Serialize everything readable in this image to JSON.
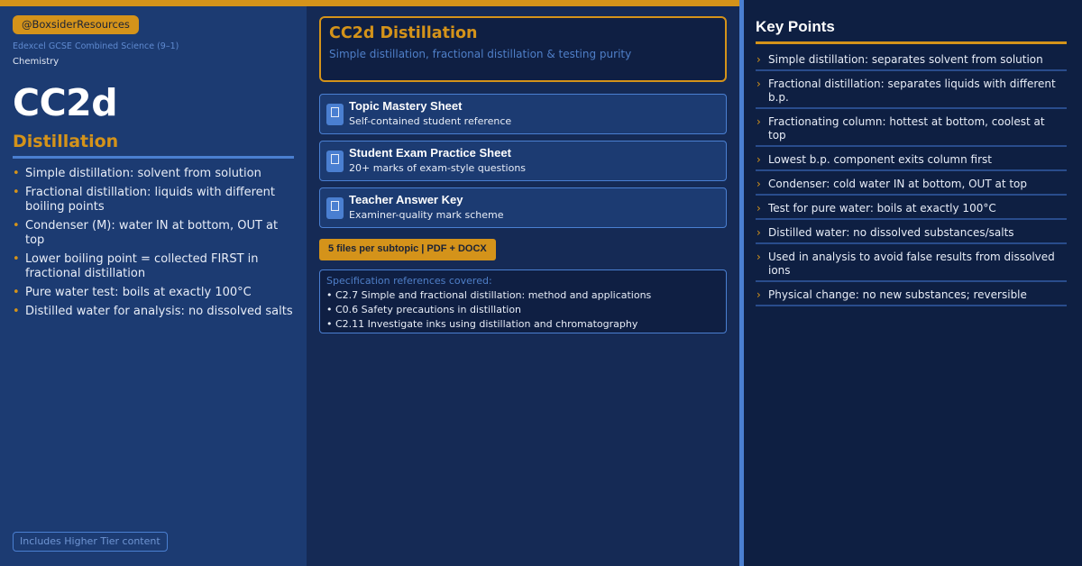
{
  "left": {
    "handle": "@BoxsiderResources",
    "board": "Edexcel GCSE Combined Science (9–1)",
    "subject": "Chemistry",
    "code": "CC2d",
    "topic": "Distillation",
    "bullets": [
      "Simple distillation: solvent from solution",
      "Fractional distillation: liquids with different boiling points",
      "Condenser (M): water IN at bottom, OUT at top",
      "Lower boiling point = collected FIRST in fractional distillation",
      "Pure water test: boils at exactly 100°C",
      "Distilled water for analysis: no dissolved salts"
    ],
    "hint": "Includes Higher Tier content"
  },
  "middle": {
    "header_title": "CC2d Distillation",
    "header_sub": "Simple distillation, fractional distillation & testing purity",
    "files": [
      {
        "name": "Topic Mastery Sheet",
        "desc": "Self-contained student reference"
      },
      {
        "name": "Student Exam Practice Sheet",
        "desc": "20+ marks of exam-style questions"
      },
      {
        "name": "Teacher Answer Key",
        "desc": "Examiner-quality mark scheme"
      }
    ],
    "badge": "5 files per subtopic  |  PDF + DOCX",
    "spec_title": "Specification references covered:",
    "spec_items": [
      "• C2.7  Simple and fractional distillation: method and applications",
      "• C0.6  Safety precautions in distillation",
      "• C2.11  Investigate inks using distillation and chromatography"
    ]
  },
  "right": {
    "title": "Key Points",
    "points": [
      "Simple distillation: separates solvent from solution",
      "Fractional distillation: separates liquids with different b.p.",
      "Fractionating column: hottest at bottom, coolest at top",
      "Lowest b.p. component exits column first",
      "Condenser: cold water IN at bottom, OUT at top",
      "Test for pure water: boils at exactly 100°C",
      "Distilled water: no dissolved substances/salts",
      "Used in analysis to avoid false results from dissolved ions",
      "Physical change: no new substances; reversible"
    ]
  },
  "icons": {
    "bullet": "•",
    "chevron": "›",
    "file": "document-icon"
  },
  "colors": {
    "accent": "#d4931a",
    "blue": "#4a7fd1",
    "left_bg": "#1c3b72",
    "middle_bg": "#152a55",
    "right_bg": "#0e1f42"
  }
}
